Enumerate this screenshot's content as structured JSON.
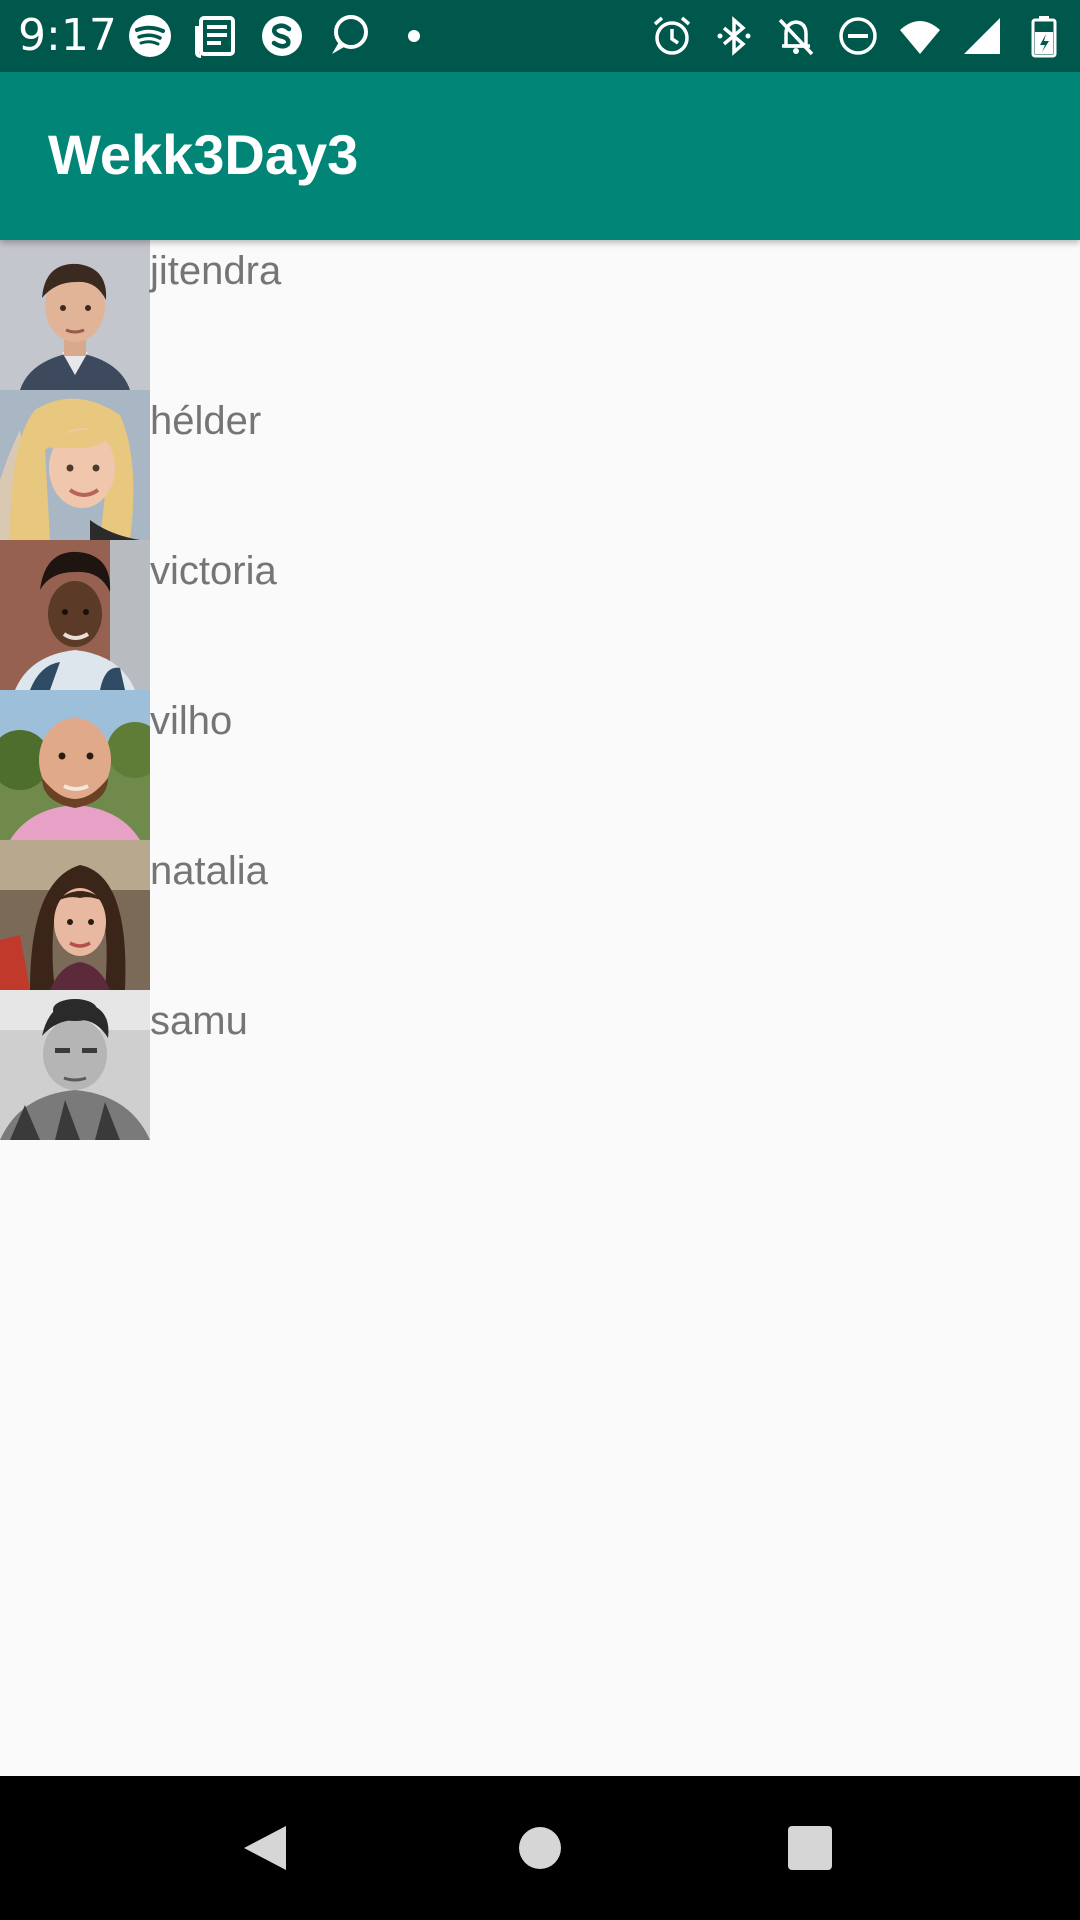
{
  "status_bar": {
    "time": "9:17",
    "left_icons": [
      "spotify-icon",
      "news-icon",
      "skype-icon",
      "chat-icon",
      "dot-icon"
    ],
    "right_icons": [
      "alarm-icon",
      "bluetooth-icon",
      "notifications-off-icon",
      "do-not-disturb-icon",
      "wifi-icon",
      "signal-icon",
      "battery-icon"
    ],
    "background": "#00574b"
  },
  "app_bar": {
    "title": "Wekk3Day3",
    "background": "#008577"
  },
  "contacts": [
    {
      "name": "jitendra"
    },
    {
      "name": "hélder"
    },
    {
      "name": "victoria"
    },
    {
      "name": "vilho"
    },
    {
      "name": "natalia"
    },
    {
      "name": "samu"
    }
  ],
  "nav_bar": {
    "buttons": [
      "back-icon",
      "home-icon",
      "recents-icon"
    ]
  }
}
